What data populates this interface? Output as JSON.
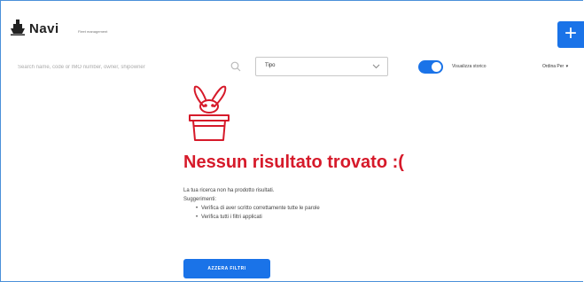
{
  "header": {
    "title": "Navi",
    "subtitle": "Fleet management",
    "add_button_label": "+"
  },
  "toolbar": {
    "search_placeholder": "Search name, code or IMO number, owner, shipowner",
    "type_select": {
      "selected": "Tipo"
    },
    "toggle": {
      "label": "Visualizza storico",
      "on": true
    },
    "sort_menu": {
      "label": "Ordina Per",
      "caret": "▾"
    }
  },
  "empty_state": {
    "title": "Nessun risultato trovato :(",
    "message": "La tua ricerca non ha prodotto risultati.",
    "suggestions_label": "Suggerimenti:",
    "suggestions": [
      "Verifica di aver scritto correttamente tutte le parole",
      "Verifica tutti i filtri applicati"
    ],
    "reset_button_label": "AZZERA FILTRI"
  },
  "colors": {
    "accent": "#1a73e8",
    "error": "#d61a2a"
  },
  "icons": {
    "logo": "ship-icon",
    "search": "search-icon",
    "select": "chevron-down-icon",
    "empty": "rabbit-hat-icon"
  }
}
